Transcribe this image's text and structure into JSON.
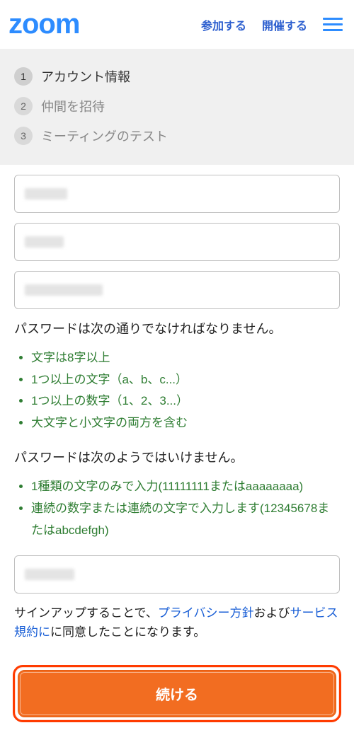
{
  "header": {
    "logo": "zoom",
    "join_label": "参加する",
    "host_label": "開催する"
  },
  "steps": [
    {
      "num": "1",
      "label": "アカウント情報"
    },
    {
      "num": "2",
      "label": "仲間を招待"
    },
    {
      "num": "3",
      "label": "ミーティングのテスト"
    }
  ],
  "password_must_title": "パスワードは次の通りでなければなりません。",
  "password_rules_must": [
    "文字は8字以上",
    "1つ以上の文字（a、b、c...）",
    "1つ以上の数字（1、2、3...）",
    "大文字と小文字の両方を含む"
  ],
  "password_mustnot_title": "パスワードは次のようではいけません。",
  "password_rules_mustnot": [
    "1種類の文字のみで入力(11111111またはaaaaaaaa)",
    "連続の数字または連続の文字で入力します(12345678またはabcdefgh)"
  ],
  "agree": {
    "prefix": "サインアップすることで、",
    "privacy_link": "プライバシー方針",
    "mid": "および",
    "terms_link": "サービス規約に",
    "suffix": "に同意したことになります。"
  },
  "continue_label": "続ける"
}
